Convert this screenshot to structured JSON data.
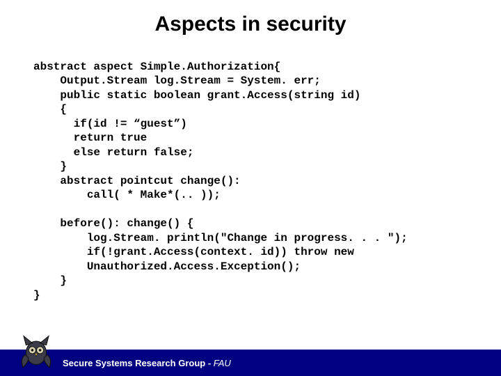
{
  "title": "Aspects in security",
  "code": {
    "l01": "abstract aspect Simple.Authorization{",
    "l02": "    Output.Stream log.Stream = System. err;",
    "l03": "    public static boolean grant.Access(string id)",
    "l04": "    {",
    "l05": "      if(id != “guest”)",
    "l06": "      return true",
    "l07": "      else return false;",
    "l08": "    }",
    "l09": "    abstract pointcut change():",
    "l10": "        call( * Make*(.. ));",
    "l11": "",
    "l12": "    before(): change() {",
    "l13": "        log.Stream. println(\"Change in progress. . . \");",
    "l14": "        if(!grant.Access(context. id)) throw new",
    "l15": "        Unauthorized.Access.Exception();",
    "l16": "    }",
    "l17": "}"
  },
  "footer": {
    "group": "Secure Systems Research Group",
    "sep": " - ",
    "org": "FAU"
  },
  "icons": {
    "owl": "owl-logo-icon"
  },
  "colors": {
    "footer_bg": "#000080",
    "text": "#000000",
    "footer_text": "#ffffff"
  }
}
